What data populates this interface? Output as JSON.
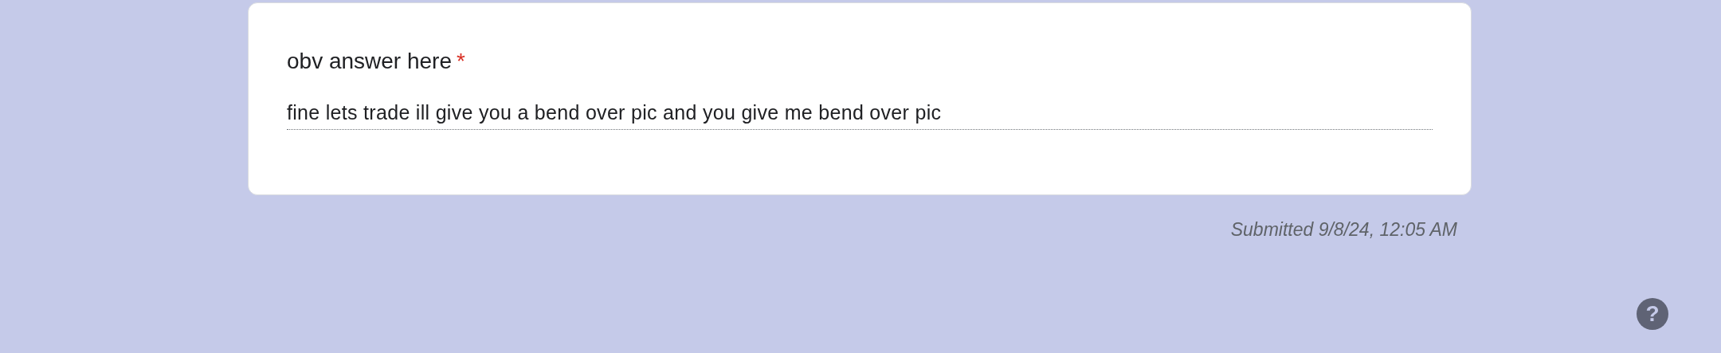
{
  "question": {
    "title": "obv answer here",
    "required_mark": "*",
    "answer": "fine lets trade ill give you a bend over pic and you give me bend over pic"
  },
  "submitted": "Submitted 9/8/24, 12:05 AM",
  "help_button": {
    "label": "?"
  }
}
